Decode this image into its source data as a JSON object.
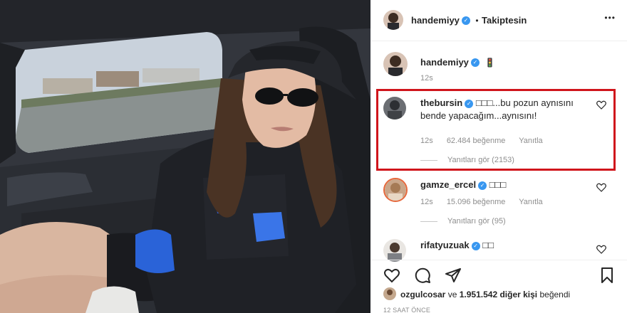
{
  "post": {
    "author": "handemiyy",
    "separator": "•",
    "follow_state": "Takiptesin",
    "more_menu": "•••"
  },
  "caption": {
    "author": "handemiyy",
    "text": "🚦",
    "time": "12s"
  },
  "comments": [
    {
      "author": "thebursin",
      "text": "□□□...bu pozun aynısını bende yapacağım...aynısını!",
      "time": "12s",
      "likes": "62.484 beğenme",
      "reply": "Yanıtla",
      "view_replies": "Yanıtları gör (2153)",
      "highlighted": true
    },
    {
      "author": "gamze_ercel",
      "text": "□□□",
      "time": "12s",
      "likes": "15.096 beğenme",
      "reply": "Yanıtla",
      "view_replies": "Yanıtları gör (95)"
    },
    {
      "author": "rifatyuzuak",
      "text": "□□"
    }
  ],
  "actions": {
    "icons": [
      "heart-icon",
      "comment-icon",
      "share-icon",
      "bookmark-icon"
    ]
  },
  "likes_line": {
    "user": "ozgulcosar",
    "joiner": "ve",
    "count": "1.951.542 diğer kişi",
    "suffix": "beğendi"
  },
  "timestamp": "12 SAAT ÖNCE",
  "colors": {
    "highlight_border": "#d0151c",
    "verified": "#3897f0",
    "muted": "#8e8e8e"
  }
}
